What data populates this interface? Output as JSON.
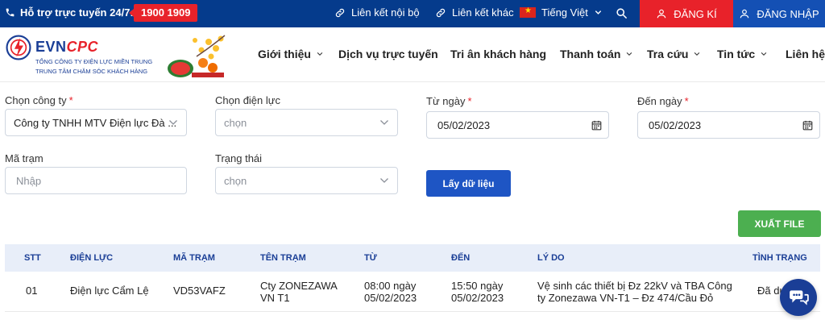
{
  "topbar": {
    "hotline_label": "Hỗ trợ trực tuyến 24/7:",
    "hotline_number": "1900 1909",
    "internal_links": "Liên kết nội bộ",
    "other_links": "Liên kết khác",
    "language": "Tiếng Việt",
    "register": "ĐĂNG KÍ",
    "login": "ĐĂNG NHẬP"
  },
  "logo": {
    "brand_evn": "EVN",
    "brand_cpc": "CPC",
    "line1": "TỔNG CÔNG TY ĐIỆN LỰC MIỀN TRUNG",
    "line2": "TRUNG TÂM CHĂM SÓC KHÁCH HÀNG"
  },
  "nav": [
    {
      "label": "Giới thiệu"
    },
    {
      "label": "Dịch vụ trực tuyến"
    },
    {
      "label": "Tri ân khách hàng"
    },
    {
      "label": "Thanh toán"
    },
    {
      "label": "Tra cứu"
    },
    {
      "label": "Tin tức"
    },
    {
      "label": "Liên hệ"
    }
  ],
  "filters": {
    "company_label": "Chọn công ty",
    "company_value": "Công ty TNHH MTV Điện lực Đà ...",
    "power_label": "Chọn điện lực",
    "power_value": "chọn",
    "from_label": "Từ ngày",
    "from_value": "05/02/2023",
    "to_label": "Đến ngày",
    "to_value": "05/02/2023",
    "station_label": "Mã trạm",
    "station_placeholder": "Nhập",
    "status_label": "Trạng thái",
    "status_value": "chọn",
    "required_mark": "*",
    "fetch_button": "Lấy dữ liệu",
    "export_button": "XUẤT FILE"
  },
  "table": {
    "headers": [
      "STT",
      "ĐIỆN LỰC",
      "MÃ TRẠM",
      "TÊN TRẠM",
      "TỪ",
      "ĐẾN",
      "LÝ DO",
      "TÌNH TRẠNG"
    ],
    "rows": [
      {
        "stt": "01",
        "dien_luc": "Điện lực Cẩm Lệ",
        "ma_tram": "VD53VAFZ",
        "ten_tram_1": "Cty ZONEZAWA",
        "ten_tram_2": "VN T1",
        "tu_1": "08:00 ngày",
        "tu_2": "05/02/2023",
        "den_1": "15:50 ngày",
        "den_2": "05/02/2023",
        "ly_do_1": "Vệ sinh các thiết bị Đz 22kV và TBA Công",
        "ly_do_2": "ty Zonezawa VN-T1 – Đz 474/Cầu Đỏ",
        "tinh_trang": "Đã du"
      }
    ]
  },
  "colors": {
    "topbar": "#053b8c",
    "accent_red": "#e8222a",
    "login_blue": "#1450b4",
    "fetch_blue": "#1e55c4",
    "export_green": "#4caf50",
    "table_header_bg": "#e8eef9"
  }
}
